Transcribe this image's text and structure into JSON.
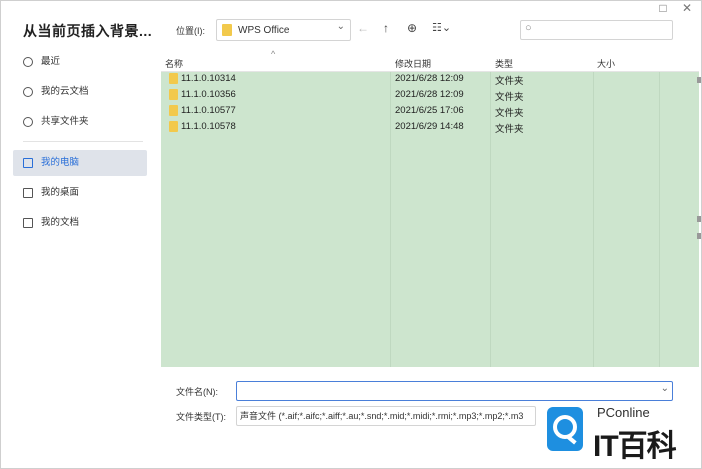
{
  "dialog": {
    "title": "从当前页插入背景..."
  },
  "window_controls": {
    "restore": "□",
    "close": "✕"
  },
  "sidebar": {
    "items": [
      {
        "label": "最近",
        "icon": "clock-icon"
      },
      {
        "label": "我的云文档",
        "icon": "cloud-doc-icon"
      },
      {
        "label": "共享文件夹",
        "icon": "share-icon"
      },
      {
        "label": "我的电脑",
        "icon": "computer-icon",
        "active": true
      },
      {
        "label": "我的桌面",
        "icon": "desktop-icon"
      },
      {
        "label": "我的文档",
        "icon": "documents-icon"
      }
    ]
  },
  "toolbar": {
    "location_label": "位置(I):",
    "location_value": "WPS Office",
    "dropdown_glyph": "⌄",
    "back_glyph": "←",
    "up_glyph": "↑",
    "new_folder_glyph": "⊕",
    "view_glyph": "☷⌄",
    "search_glyph": "○"
  },
  "file_list": {
    "sort_glyph": "^",
    "columns": [
      "名称",
      "修改日期",
      "类型",
      "大小"
    ],
    "rows": [
      {
        "name": "11.1.0.10314",
        "date": "2021/6/28 12:09",
        "type": "文件夹",
        "size": ""
      },
      {
        "name": "11.1.0.10356",
        "date": "2021/6/28 12:09",
        "type": "文件夹",
        "size": ""
      },
      {
        "name": "11.1.0.10577",
        "date": "2021/6/25 17:06",
        "type": "文件夹",
        "size": ""
      },
      {
        "name": "11.1.0.10578",
        "date": "2021/6/29 14:48",
        "type": "文件夹",
        "size": ""
      }
    ]
  },
  "form": {
    "filename_label": "文件名(N):",
    "filename_value": "",
    "filename_dropdown": "⌄",
    "filetype_label": "文件类型(T):",
    "filetype_value": "声音文件 (*.aif;*.aifc;*.aiff;*.au;*.snd;*.mid;*.midi;*.rmi;*.mp3;*.mp2;*.m3"
  },
  "watermark": {
    "brand": "PConline",
    "name": "IT百科"
  }
}
